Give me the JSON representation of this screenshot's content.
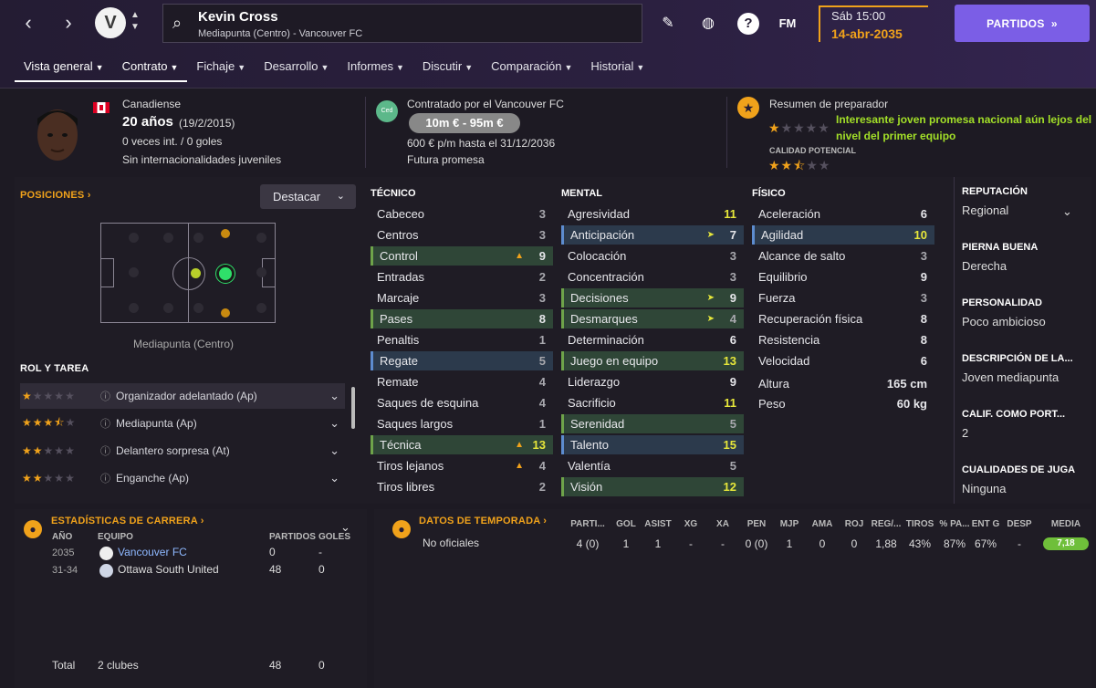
{
  "header": {
    "player_name": "Kevin Cross",
    "player_subtitle": "Mediapunta (Centro) - Vancouver FC",
    "fm_label": "FM",
    "date_day": "Sáb 15:00",
    "date_full": "14-abr-2035",
    "partidos_label": "PARTIDOS"
  },
  "tabs": [
    "Vista general",
    "Contrato",
    "Fichaje",
    "Desarrollo",
    "Informes",
    "Discutir",
    "Comparación",
    "Historial"
  ],
  "profile": {
    "nationality": "Canadiense",
    "age": "20 años",
    "dob": "(19/2/2015)",
    "caps": "0 veces int. / 0 goles",
    "youth": "Sin internacionalidades juveniles"
  },
  "contract": {
    "hired_by": "Contratado por el Vancouver FC",
    "badge": "Ced",
    "value": "10m € - 95m €",
    "wage": "600 € p/m hasta el 31/12/2036",
    "status": "Futura promesa"
  },
  "coach": {
    "title": "Resumen de preparador",
    "comment": "Interesante joven promesa nacional aún lejos del nivel del primer equipo",
    "potential_label": "CALIDAD POTENCIAL",
    "current_stars": 1,
    "potential_stars": 2.5
  },
  "positions": {
    "label": "POSICIONES",
    "dropdown": "Destacar",
    "caption": "Mediapunta (Centro)"
  },
  "roles": {
    "label": "ROL Y TAREA",
    "items": [
      {
        "name": "Organizador adelantado (Ap)",
        "stars": 1
      },
      {
        "name": "Mediapunta (Ap)",
        "stars": 3.5
      },
      {
        "name": "Delantero sorpresa (At)",
        "stars": 2
      },
      {
        "name": "Enganche (Ap)",
        "stars": 2
      }
    ]
  },
  "technical": {
    "label": "TÉCNICO",
    "items": [
      {
        "n": "Cabeceo",
        "v": "3"
      },
      {
        "n": "Centros",
        "v": "3"
      },
      {
        "n": "Control",
        "v": "9"
      },
      {
        "n": "Entradas",
        "v": "2"
      },
      {
        "n": "Marcaje",
        "v": "3"
      },
      {
        "n": "Pases",
        "v": "8"
      },
      {
        "n": "Penaltis",
        "v": "1"
      },
      {
        "n": "Regate",
        "v": "5"
      },
      {
        "n": "Remate",
        "v": "4"
      },
      {
        "n": "Saques de esquina",
        "v": "4"
      },
      {
        "n": "Saques largos",
        "v": "1"
      },
      {
        "n": "Técnica",
        "v": "13"
      },
      {
        "n": "Tiros lejanos",
        "v": "4"
      },
      {
        "n": "Tiros libres",
        "v": "2"
      }
    ]
  },
  "mental": {
    "label": "MENTAL",
    "items": [
      {
        "n": "Agresividad",
        "v": "11"
      },
      {
        "n": "Anticipación",
        "v": "7"
      },
      {
        "n": "Colocación",
        "v": "3"
      },
      {
        "n": "Concentración",
        "v": "3"
      },
      {
        "n": "Decisiones",
        "v": "9"
      },
      {
        "n": "Desmarques",
        "v": "4"
      },
      {
        "n": "Determinación",
        "v": "6"
      },
      {
        "n": "Juego en equipo",
        "v": "13"
      },
      {
        "n": "Liderazgo",
        "v": "9"
      },
      {
        "n": "Sacrificio",
        "v": "11"
      },
      {
        "n": "Serenidad",
        "v": "5"
      },
      {
        "n": "Talento",
        "v": "15"
      },
      {
        "n": "Valentía",
        "v": "5"
      },
      {
        "n": "Visión",
        "v": "12"
      }
    ]
  },
  "physical": {
    "label": "FÍSICO",
    "items": [
      {
        "n": "Aceleración",
        "v": "6"
      },
      {
        "n": "Agilidad",
        "v": "10"
      },
      {
        "n": "Alcance de salto",
        "v": "3"
      },
      {
        "n": "Equilibrio",
        "v": "9"
      },
      {
        "n": "Fuerza",
        "v": "3"
      },
      {
        "n": "Recuperación física",
        "v": "8"
      },
      {
        "n": "Resistencia",
        "v": "8"
      },
      {
        "n": "Velocidad",
        "v": "6"
      }
    ],
    "height_label": "Altura",
    "height": "165 cm",
    "weight_label": "Peso",
    "weight": "60 kg"
  },
  "sidebar": [
    {
      "label": "REPUTACIÓN",
      "value": "Regional"
    },
    {
      "label": "PIERNA BUENA",
      "value": "Derecha"
    },
    {
      "label": "PERSONALIDAD",
      "value": "Poco ambicioso"
    },
    {
      "label": "DESCRIPCIÓN DE LA...",
      "value": "Joven mediapunta"
    },
    {
      "label": "CALIF. COMO PORT...",
      "value": "2"
    },
    {
      "label": "CUALIDADES DE JUGA",
      "value": "Ninguna"
    }
  ],
  "career": {
    "title": "ESTADÍSTICAS DE CARRERA",
    "headers": {
      "year": "AÑO",
      "team": "EQUIPO",
      "apps": "PARTIDOS",
      "goals": "GOLES"
    },
    "rows": [
      {
        "year": "2035",
        "team": "Vancouver FC",
        "apps": "0",
        "goals": "-"
      },
      {
        "year": "31-34",
        "team": "Ottawa South United",
        "apps": "48",
        "goals": "0"
      }
    ],
    "total": {
      "label": "Total",
      "team": "2 clubes",
      "apps": "48",
      "goals": "0"
    }
  },
  "season": {
    "title": "DATOS DE TEMPORADA",
    "headers": [
      "PARTI...",
      "GOL",
      "ASIST",
      "XG",
      "XA",
      "PEN",
      "MJP",
      "AMA",
      "ROJ",
      "REG/...",
      "TIROS",
      "% PA...",
      "ENT G",
      "DESP",
      "MEDIA"
    ],
    "row_label": "No oficiales",
    "values": [
      "4 (0)",
      "1",
      "1",
      "-",
      "-",
      "0 (0)",
      "1",
      "0",
      "0",
      "1,88",
      "43%",
      "87%",
      "67%",
      "-",
      "7,18"
    ]
  },
  "colors": {
    "accent": "#f0a21b",
    "purple": "#7b5ee6",
    "good": "#a3e028"
  }
}
